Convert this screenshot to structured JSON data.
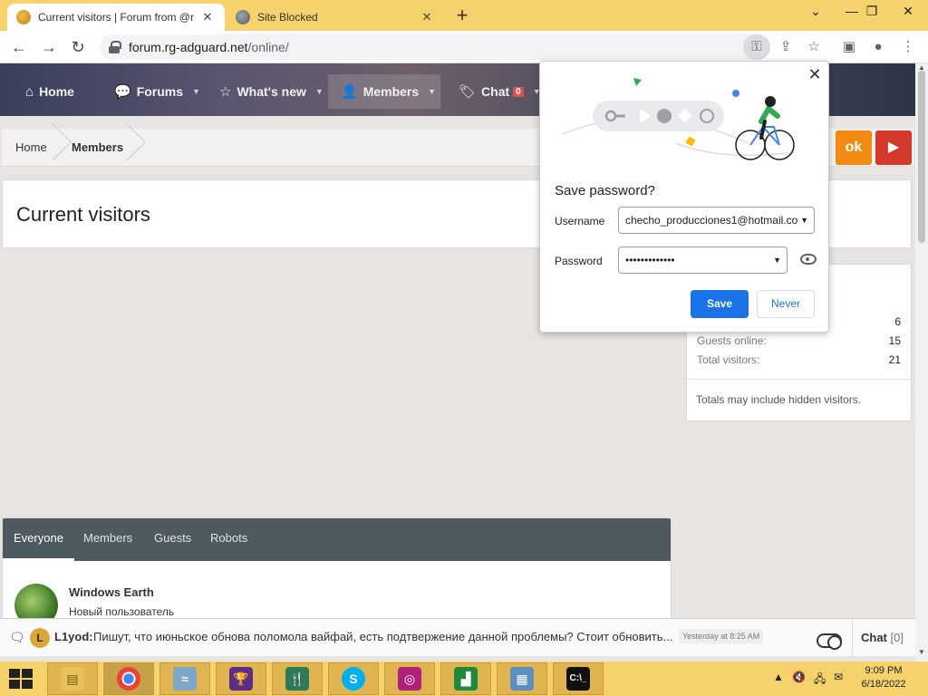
{
  "browser": {
    "tabs": [
      {
        "title": "Current visitors | Forum from @r",
        "active": true
      },
      {
        "title": "Site Blocked",
        "active": false
      }
    ],
    "new_tab": "+",
    "window_controls": {
      "minimize": "⌄",
      "restore": "—",
      "maximize": "❐",
      "close": "✕"
    },
    "url_host": "forum.rg-adguard.net",
    "url_path": "/online/"
  },
  "site_nav": {
    "items": [
      {
        "label": "Home",
        "icon": "home-icon"
      },
      {
        "label": "Forums",
        "icon": "forums-icon"
      },
      {
        "label": "What's new",
        "icon": "star-icon"
      },
      {
        "label": "Members",
        "icon": "user-icon"
      },
      {
        "label": "Chat",
        "icon": "tag-icon",
        "badge": "0"
      }
    ]
  },
  "breadcrumb": {
    "items": [
      "Home",
      "Members"
    ]
  },
  "page_title": "Current visitors",
  "stats": {
    "rows": [
      {
        "label": "",
        "value": "6"
      },
      {
        "label": "Guests online:",
        "value": "15"
      },
      {
        "label": "Total visitors:",
        "value": "21"
      }
    ],
    "note": "Totals may include hidden visitors."
  },
  "members": {
    "tabs": [
      "Everyone",
      "Members",
      "Guests",
      "Robots"
    ],
    "active_tab": "Everyone",
    "list": [
      {
        "name": "Windows Earth",
        "role": "Новый пользователь"
      }
    ]
  },
  "chat": {
    "avatar_letter": "L",
    "user": "L1yod:",
    "message": "Пишут, что июньское обнова поломола вайфай, есть подтвержение данной проблемы? Стоит обновить...",
    "time": "Yesterday at 8:25 AM",
    "button_label": "Chat",
    "button_count": "[0]"
  },
  "password_popup": {
    "title": "Save password?",
    "username_label": "Username",
    "username_value": "checho_producciones1@hotmail.co",
    "password_label": "Password",
    "password_value": "•••••••••••••",
    "save_label": "Save",
    "never_label": "Never",
    "close_label": "✕"
  },
  "taskbar": {
    "time": "9:09 PM",
    "date": "6/18/2022"
  },
  "colors": {
    "tabbar": "#f5d26b",
    "accent_blue": "#1a73e8",
    "members_tabs_bg": "#4e5a60"
  }
}
